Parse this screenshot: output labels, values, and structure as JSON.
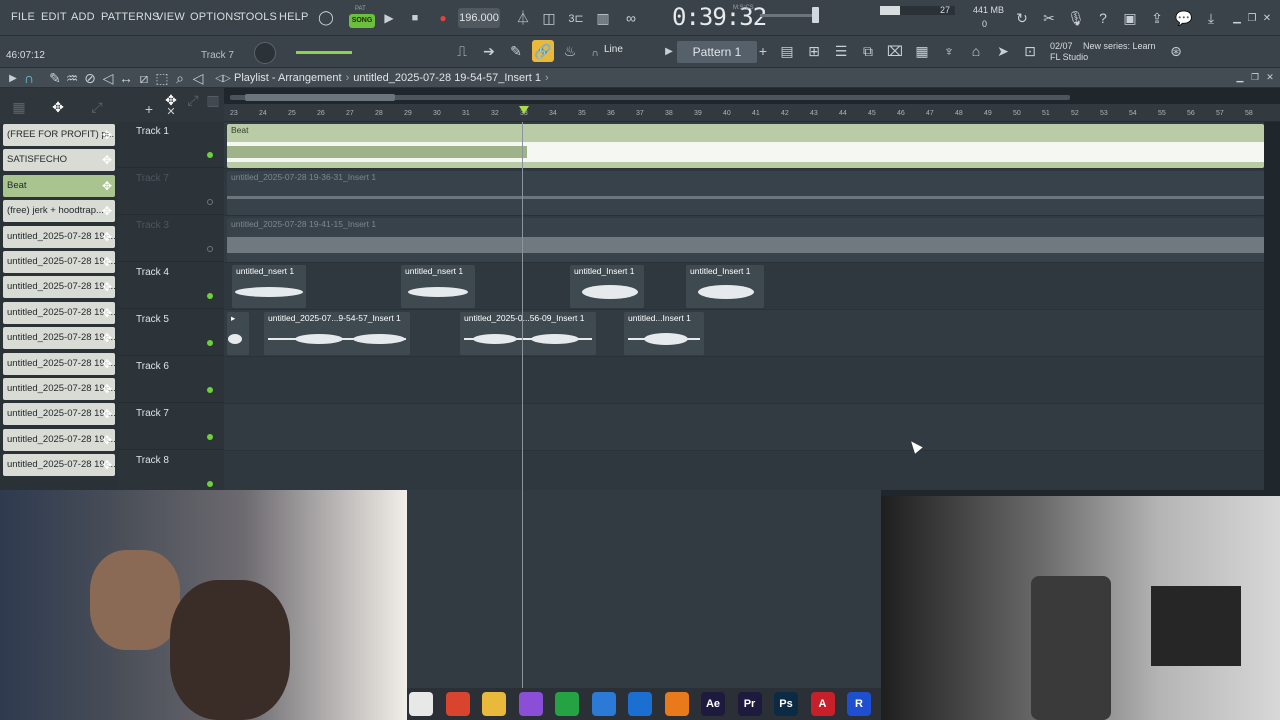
{
  "menu": [
    "FILE",
    "EDIT",
    "ADD",
    "PATTERNS",
    "VIEW",
    "OPTIONS",
    "TOOLS",
    "HELP"
  ],
  "transport": {
    "mode": "SONG",
    "pat_label": "PAT",
    "bpm": "196.000",
    "time": "0:39:32",
    "time_unit": "M:S:CS"
  },
  "performance": {
    "polyphony": "27",
    "memory": "441 MB",
    "memory_sub": "0"
  },
  "hint_bar": {
    "time": "46:07:12",
    "selected_track": "Track 7"
  },
  "toolbar2": {
    "snap_mode": "Line",
    "pattern": "Pattern 1"
  },
  "news": {
    "date": "02/07",
    "text": "New series: Learn",
    "sub": "FL Studio"
  },
  "playlist": {
    "title": "Playlist - Arrangement",
    "file": "untitled_2025-07-28 19-54-57_Insert 1"
  },
  "picker_items": [
    {
      "label": "(FREE FOR PROFIT) pl...",
      "color": "#d9dcd4"
    },
    {
      "label": "SATISFECHO",
      "color": "#d9dcd4"
    },
    {
      "label": "Beat",
      "color": "#a9c48e"
    },
    {
      "label": "(free) jerk + hoodtrap...",
      "color": "#d9dcd4"
    },
    {
      "label": "untitled_2025-07-28 19-...",
      "color": "#d9dcd4"
    },
    {
      "label": "untitled_2025-07-28 19-...",
      "color": "#d9dcd4"
    },
    {
      "label": "untitled_2025-07-28 19-...",
      "color": "#d9dcd4"
    },
    {
      "label": "untitled_2025-07-28 19-...",
      "color": "#d9dcd4"
    },
    {
      "label": "untitled_2025-07-28 19-...",
      "color": "#d9dcd4"
    },
    {
      "label": "untitled_2025-07-28 19-...",
      "color": "#d9dcd4"
    },
    {
      "label": "untitled_2025-07-28 19-...",
      "color": "#d9dcd4"
    },
    {
      "label": "untitled_2025-07-28 19-...",
      "color": "#d9dcd4"
    },
    {
      "label": "untitled_2025-07-28 19-...",
      "color": "#d9dcd4"
    },
    {
      "label": "untitled_2025-07-28 19-...",
      "color": "#d9dcd4"
    }
  ],
  "tracks": [
    {
      "name": "Track 1",
      "muted": false
    },
    {
      "name": "Track 7",
      "muted": true
    },
    {
      "name": "Track 3",
      "muted": true
    },
    {
      "name": "Track 4",
      "muted": false
    },
    {
      "name": "Track 5",
      "muted": false
    },
    {
      "name": "Track 6",
      "muted": false
    },
    {
      "name": "Track 7",
      "muted": false
    },
    {
      "name": "Track 8",
      "muted": false
    }
  ],
  "ruler_numbers": [
    "23",
    "24",
    "25",
    "26",
    "27",
    "28",
    "29",
    "30",
    "31",
    "32",
    "33",
    "34",
    "35",
    "36",
    "37",
    "38",
    "39",
    "40",
    "41",
    "42",
    "43",
    "44",
    "45",
    "46",
    "47",
    "48",
    "49",
    "50",
    "51",
    "52",
    "53",
    "54",
    "55",
    "56",
    "57",
    "58"
  ],
  "clips": {
    "beat": "Beat",
    "ghost1": "untitled_2025-07-28 19-36-31_Insert 1",
    "ghost2": "untitled_2025-07-28 19-41-15_Insert 1",
    "t4": [
      "untitled_nsert 1",
      "untitled_nsert 1",
      "untitled_Insert 1",
      "untitled_Insert 1"
    ],
    "t5": [
      "untitled_2025-07...9-54-57_Insert 1",
      "untitled_2025-0...56-09_Insert 1",
      "untitled...Insert 1"
    ]
  },
  "taskbar_apps": [
    {
      "name": "files",
      "glyph": "",
      "color": "#e8e8e8"
    },
    {
      "name": "chrome",
      "glyph": "",
      "color": "#d9442f"
    },
    {
      "name": "explorer",
      "glyph": "",
      "color": "#e8b93a"
    },
    {
      "name": "copilot",
      "glyph": "",
      "color": "#8a4fd6"
    },
    {
      "name": "whatsapp",
      "glyph": "",
      "color": "#25a244"
    },
    {
      "name": "app-blue",
      "glyph": "",
      "color": "#2a7ad6"
    },
    {
      "name": "outlook",
      "glyph": "",
      "color": "#1b6fd1"
    },
    {
      "name": "fl-studio",
      "glyph": "",
      "color": "#e87a1c"
    },
    {
      "name": "after-effects",
      "glyph": "Ae",
      "color": "#1d1a3e"
    },
    {
      "name": "premiere",
      "glyph": "Pr",
      "color": "#1d1a3e"
    },
    {
      "name": "photoshop",
      "glyph": "Ps",
      "color": "#0b2a44"
    },
    {
      "name": "acrobat",
      "glyph": "A",
      "color": "#c8202a"
    },
    {
      "name": "app-r",
      "glyph": "R",
      "color": "#1f4fd1"
    }
  ]
}
